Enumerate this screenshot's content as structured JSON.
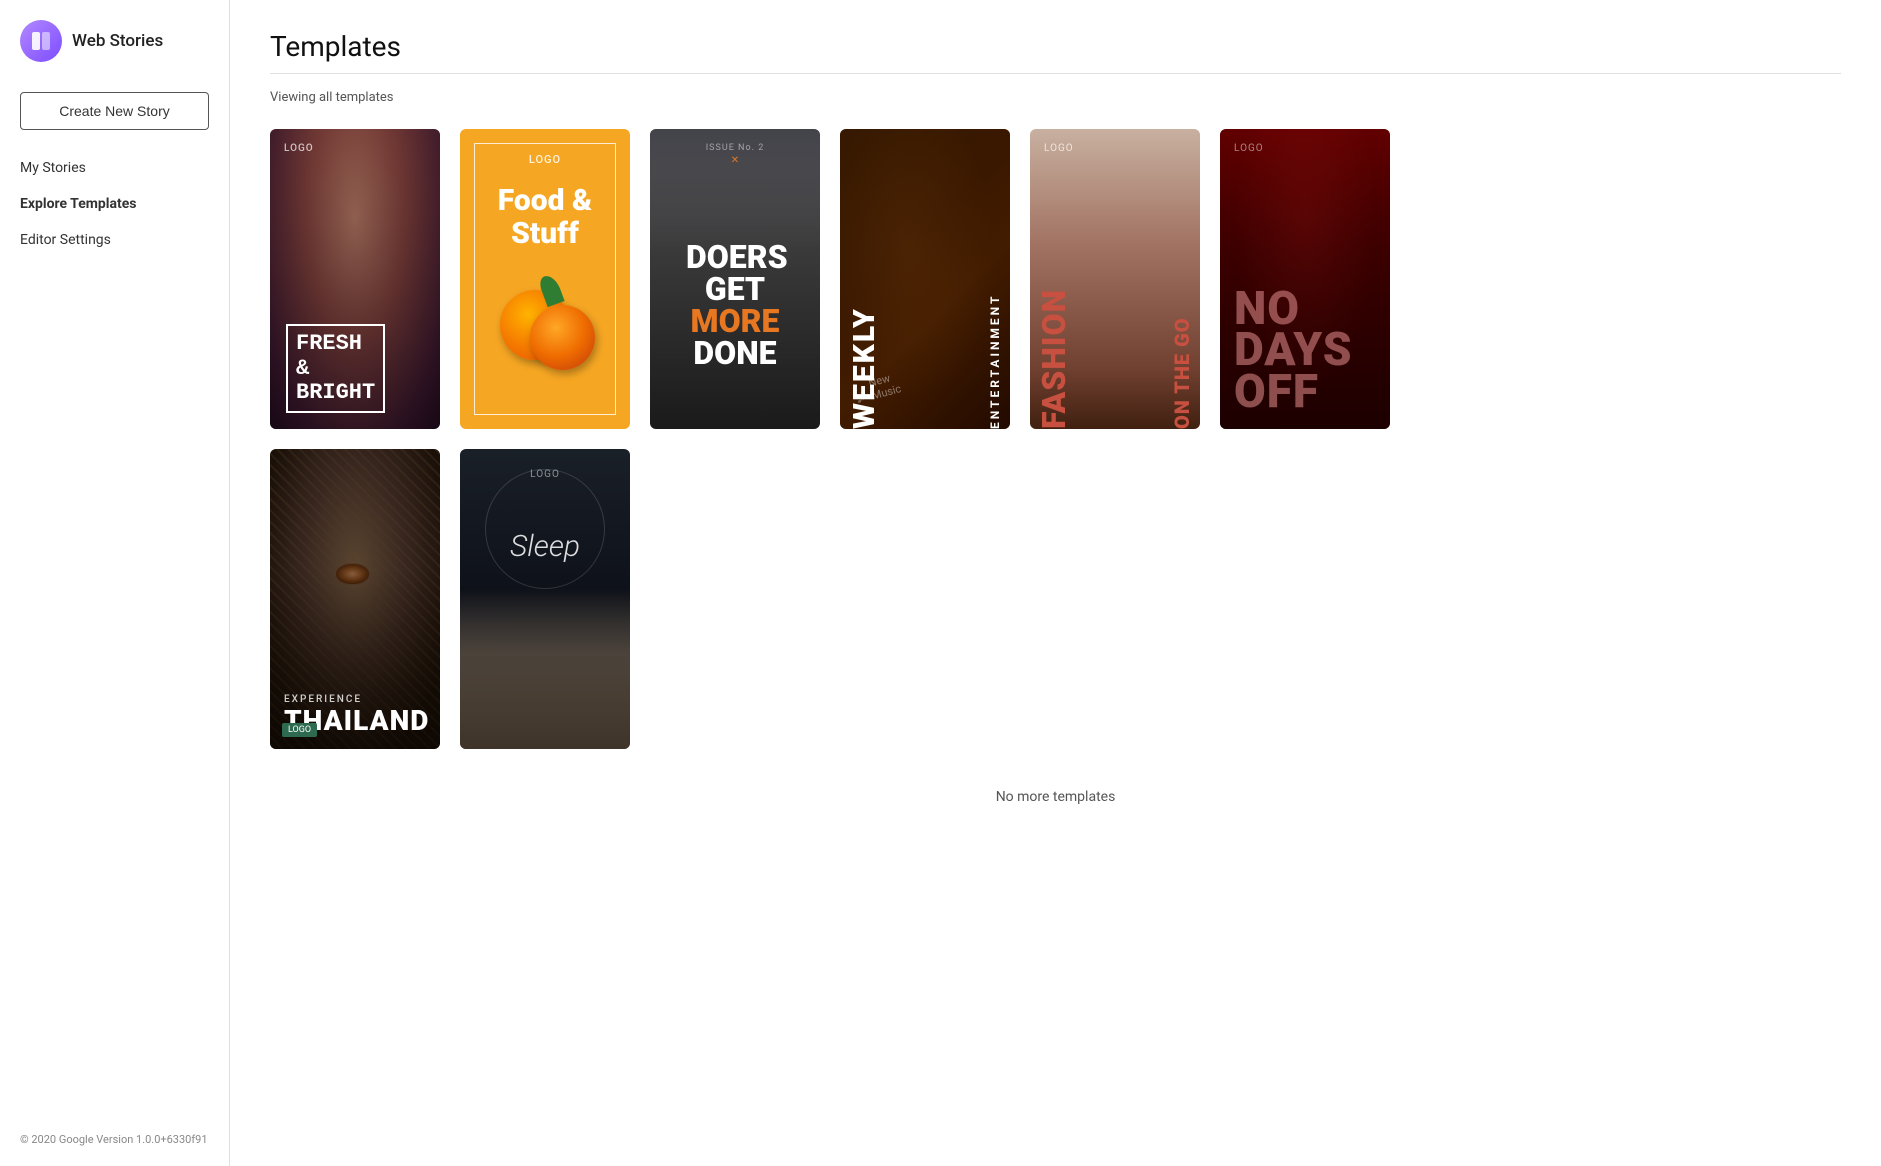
{
  "sidebar": {
    "logo_text": "Web Stories",
    "create_btn": "Create New Story",
    "nav_items": [
      {
        "id": "my-stories",
        "label": "My Stories",
        "active": false
      },
      {
        "id": "explore-templates",
        "label": "Explore Templates",
        "active": true
      },
      {
        "id": "editor-settings",
        "label": "Editor Settings",
        "active": false
      }
    ],
    "footer_text": "© 2020 Google Version 1.0.0+6330f91"
  },
  "main": {
    "page_title": "Templates",
    "viewing_text": "Viewing all templates",
    "no_more_text": "No more templates",
    "templates": [
      {
        "id": "fresh-bright",
        "name": "Fresh & Bright",
        "type": "beauty"
      },
      {
        "id": "food-stuff",
        "name": "Food & Stuff",
        "type": "food"
      },
      {
        "id": "doers",
        "name": "Doers Get More Done",
        "type": "motivation"
      },
      {
        "id": "weekly-entertainment",
        "name": "Weekly Entertainment",
        "type": "entertainment"
      },
      {
        "id": "fashion-go",
        "name": "Fashion On The Go",
        "type": "fashion"
      },
      {
        "id": "no-days-off",
        "name": "No Days Off",
        "type": "fitness"
      },
      {
        "id": "experience-thailand",
        "name": "Experience Thailand",
        "type": "travel"
      },
      {
        "id": "sleep",
        "name": "Sleep",
        "type": "wellness"
      }
    ]
  }
}
